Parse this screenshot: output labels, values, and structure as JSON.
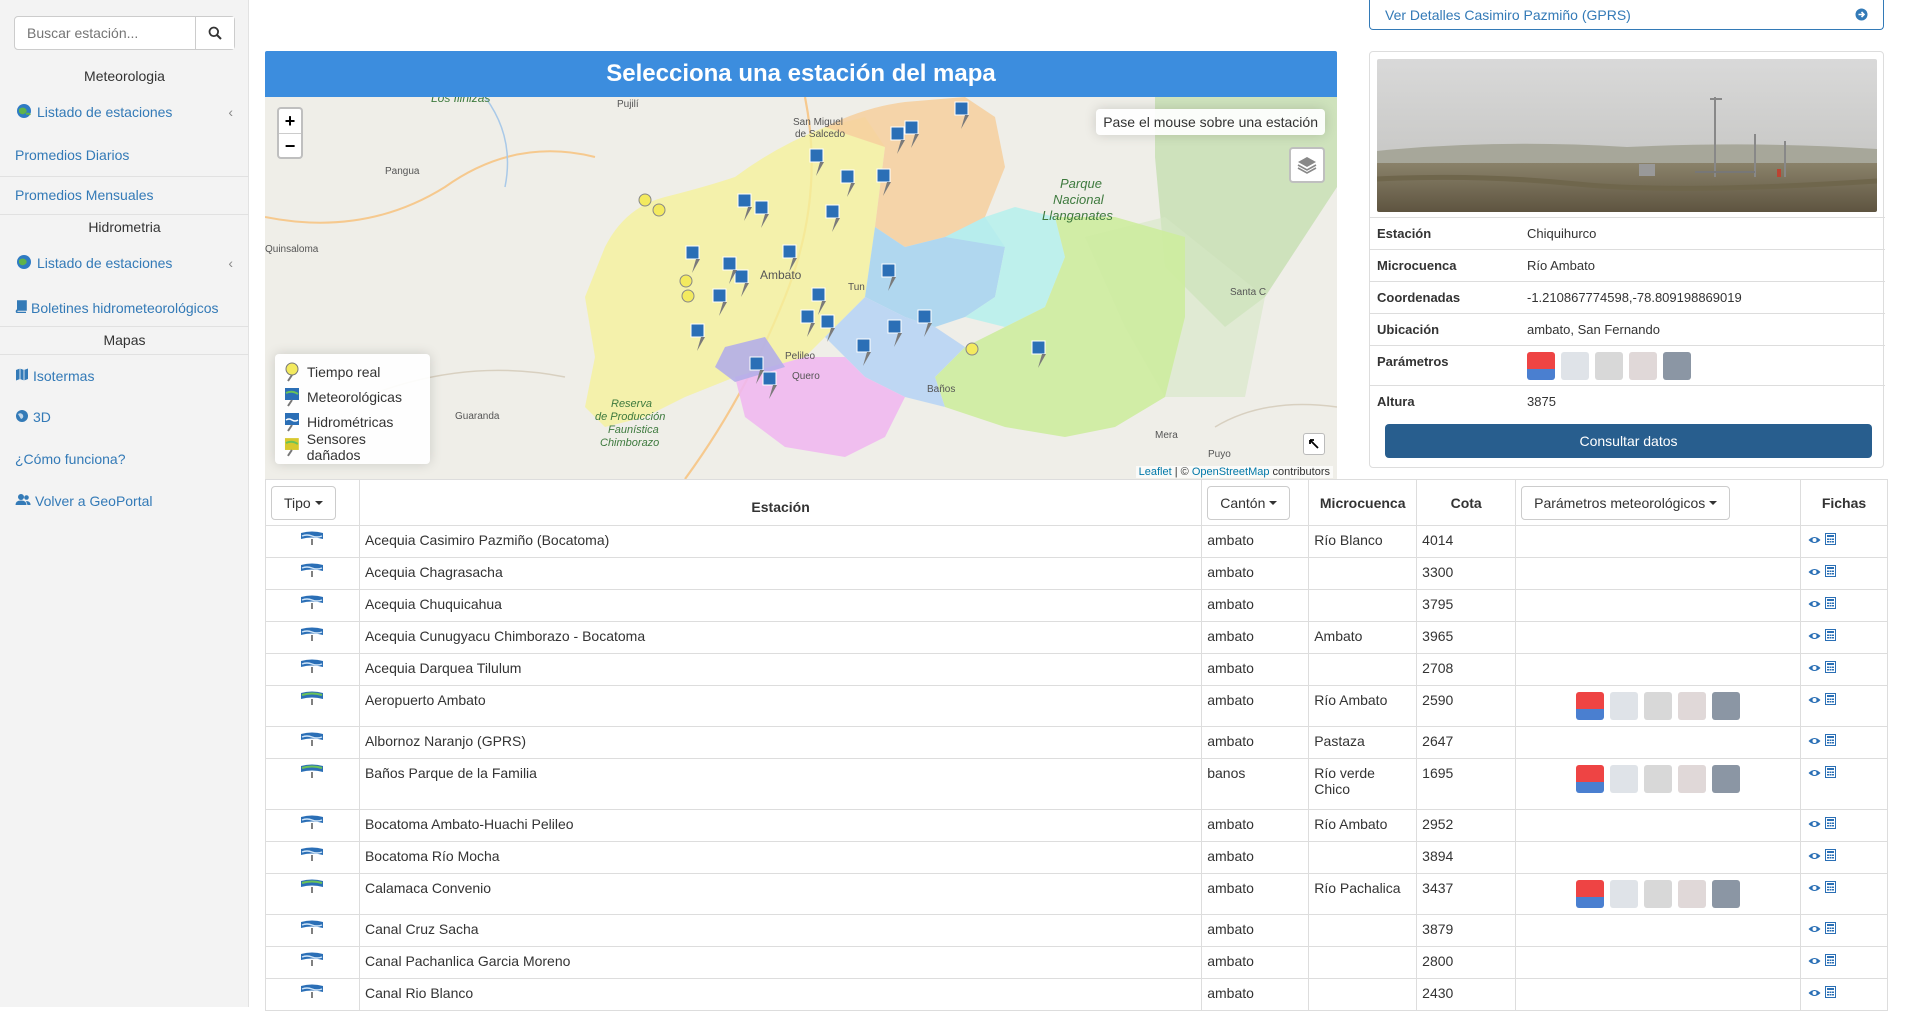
{
  "sidebar": {
    "search_placeholder": "Buscar estación...",
    "sections": {
      "meteo": "Meteorologia",
      "hidro": "Hidrometria",
      "mapas": "Mapas"
    },
    "items": {
      "listado_meteo": "Listado de estaciones",
      "promedios_diarios": "Promedios Diarios",
      "promedios_mensuales": "Promedios Mensuales",
      "listado_hidro": "Listado de estaciones",
      "boletines": "Boletines hidrometeorológicos",
      "isotermas": "Isotermas",
      "tres_d": "3D",
      "como_funciona": "¿Cómo funciona?",
      "volver": "Volver a GeoPortal"
    }
  },
  "map": {
    "title": "Selecciona una estación del mapa",
    "hover_hint": "Pase el mouse sobre una estación",
    "zoom_in": "+",
    "zoom_out": "−",
    "legend": {
      "tiempo_real": "Tiempo real",
      "meteorologicas": "Meteorológicas",
      "hidrometricas": "Hidrométricas",
      "sensores": "Sensores dañados"
    },
    "attribution": {
      "leaflet": "Leaflet",
      "sep": " | © ",
      "osm": "OpenStreetMap",
      "contributors": " contributors"
    },
    "places": {
      "salcedo": "San Miguel\nde Salcedo",
      "pujili": "Pujilí",
      "pangua": "Pangua",
      "quinsaloma": "Quinsaloma",
      "ambato": "Ambato",
      "parque": "Parque\nNacional\nLlanganates",
      "santa": "Santa C",
      "banos": "Baños",
      "mera": "Mera",
      "puyo": "Puyo",
      "guaranda": "Guaranda",
      "reserva": "Reserva\nde Producción\nFaunística\nChimborazo",
      "losinizas": "Los Ilinizas",
      "pelileo": "Pelileo",
      "quero": "Quero",
      "tungurahua": "Tun"
    }
  },
  "details": {
    "link": "Ver Detalles Casimiro Pazmiño (GPRS)",
    "rows": [
      {
        "k": "Estación",
        "v": "Chiquihurco"
      },
      {
        "k": "Microcuenca",
        "v": "Río Ambato"
      },
      {
        "k": "Coordenadas",
        "v": "-1.210867774598,-78.809198869019"
      },
      {
        "k": "Ubicación",
        "v": "ambato, San Fernando"
      },
      {
        "k": "Parámetros",
        "v": ""
      },
      {
        "k": "Altura",
        "v": "3875"
      }
    ],
    "consult_button": "Consultar datos"
  },
  "table": {
    "headers": {
      "tipo": "Tipo",
      "estacion": "Estación",
      "canton": "Cantón",
      "microcuenca": "Microcuenca",
      "cota": "Cota",
      "parametros": "Parámetros meteorológicos",
      "fichas": "Fichas"
    },
    "rows": [
      {
        "tipo": "hidro",
        "estacion": "Acequia Casimiro Pazmiño (Bocatoma)",
        "canton": "ambato",
        "micro": "Río Blanco",
        "cota": "4014",
        "params": false
      },
      {
        "tipo": "hidro",
        "estacion": "Acequia Chagrasacha",
        "canton": "ambato",
        "micro": "",
        "cota": "3300",
        "params": false
      },
      {
        "tipo": "hidro",
        "estacion": "Acequia Chuquicahua",
        "canton": "ambato",
        "micro": "",
        "cota": "3795",
        "params": false
      },
      {
        "tipo": "hidro",
        "estacion": "Acequia Cunugyacu Chimborazo - Bocatoma",
        "canton": "ambato",
        "micro": "Ambato",
        "cota": "3965",
        "params": false
      },
      {
        "tipo": "hidro",
        "estacion": "Acequia Darquea Tilulum",
        "canton": "ambato",
        "micro": "",
        "cota": "2708",
        "params": false
      },
      {
        "tipo": "meteo",
        "estacion": "Aeropuerto Ambato",
        "canton": "ambato",
        "micro": "Río Ambato",
        "cota": "2590",
        "params": true
      },
      {
        "tipo": "hidro",
        "estacion": "Albornoz Naranjo (GPRS)",
        "canton": "ambato",
        "micro": "Pastaza",
        "cota": "2647",
        "params": false
      },
      {
        "tipo": "meteo",
        "estacion": "Baños Parque de la Familia",
        "canton": "banos",
        "micro": "Río verde Chico",
        "cota": "1695",
        "params": true
      },
      {
        "tipo": "hidro",
        "estacion": "Bocatoma Ambato-Huachi Pelileo",
        "canton": "ambato",
        "micro": "Río Ambato",
        "cota": "2952",
        "params": false
      },
      {
        "tipo": "hidro",
        "estacion": "Bocatoma Río Mocha",
        "canton": "ambato",
        "micro": "",
        "cota": "3894",
        "params": false
      },
      {
        "tipo": "meteo",
        "estacion": "Calamaca Convenio",
        "canton": "ambato",
        "micro": "Río Pachalica",
        "cota": "3437",
        "params": true
      },
      {
        "tipo": "hidro",
        "estacion": "Canal Cruz Sacha",
        "canton": "ambato",
        "micro": "",
        "cota": "3879",
        "params": false
      },
      {
        "tipo": "hidro",
        "estacion": "Canal Pachanlica Garcia Moreno",
        "canton": "ambato",
        "micro": "",
        "cota": "2800",
        "params": false
      },
      {
        "tipo": "hidro",
        "estacion": "Canal Rio Blanco",
        "canton": "ambato",
        "micro": "",
        "cota": "2430",
        "params": false
      }
    ]
  }
}
